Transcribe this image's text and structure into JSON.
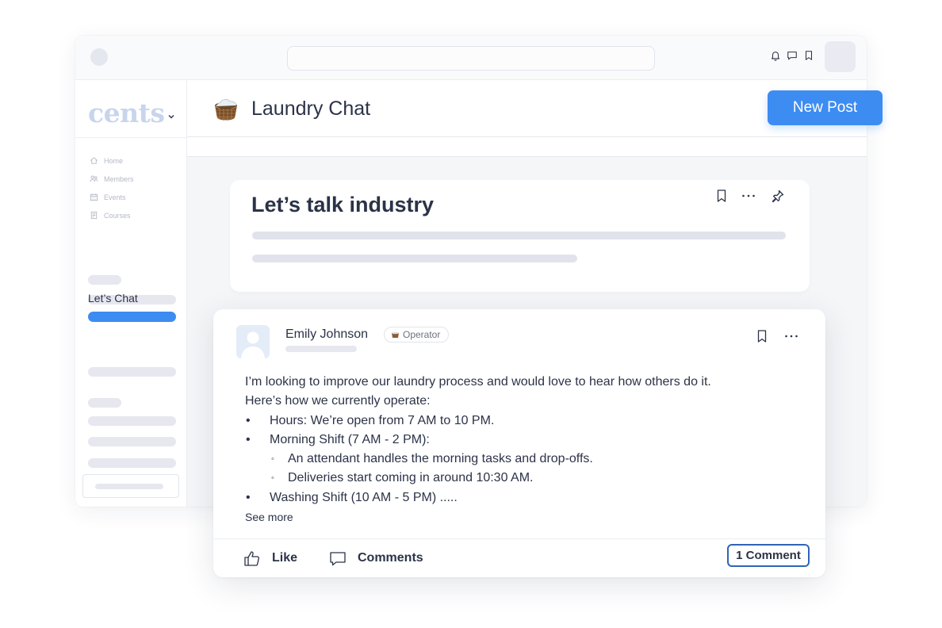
{
  "sidebar": {
    "logo": "cents",
    "nav": [
      {
        "label": "Home",
        "icon": "home-icon"
      },
      {
        "label": "Members",
        "icon": "members-icon"
      },
      {
        "label": "Events",
        "icon": "calendar-icon"
      },
      {
        "label": "Courses",
        "icon": "courses-icon"
      }
    ],
    "section_label": "Let’s Chat"
  },
  "header": {
    "channel_title": "Laundry Chat",
    "channel_icon": "laundry-basket-icon",
    "new_post_label": "New Post"
  },
  "topic": {
    "title": "Let’s talk industry"
  },
  "post": {
    "author": "Emily Johnson",
    "role": "Operator",
    "lines": [
      "I’m looking to improve our laundry process and would love to hear how others do it.",
      "Here’s how we currently operate:"
    ],
    "bullets": [
      {
        "marker": "•",
        "text": "Hours: We’re open from 7 AM to 10 PM."
      },
      {
        "marker": "•",
        "text": "Morning Shift (7 AM - 2 PM):"
      }
    ],
    "sub_bullets": [
      {
        "marker": "◦",
        "text": "An attendant handles the morning tasks and drop-offs."
      },
      {
        "marker": "◦",
        "text": "Deliveries start coming in around 10:30 AM."
      }
    ],
    "last_bullet": {
      "marker": "•",
      "text": "Washing Shift (10 AM - 5 PM) ....."
    },
    "see_more": "See more",
    "like_label": "Like",
    "comments_label": "Comments",
    "comment_count": "1 Comment"
  },
  "colors": {
    "accent": "#3d8cf2",
    "comment_border": "#2e65b6",
    "text": "#2b3347",
    "logo": "#c8d5ec"
  }
}
